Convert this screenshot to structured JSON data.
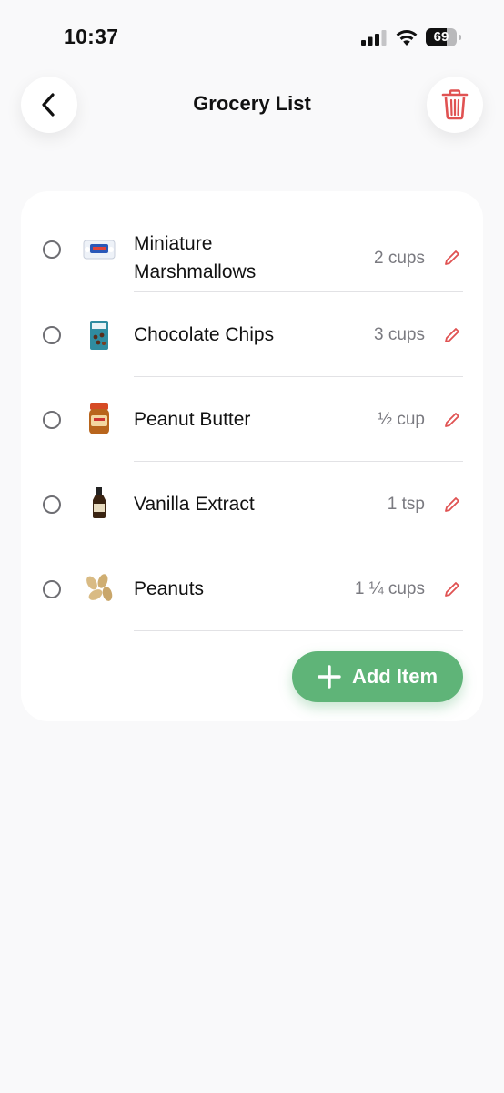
{
  "status": {
    "time": "10:37",
    "battery": "69",
    "battery_level": 0.69
  },
  "header": {
    "title": "Grocery List",
    "back_icon": "chevron-left-icon",
    "delete_icon": "trash-icon"
  },
  "items": [
    {
      "name": "Miniature Marshmallows",
      "quantity": "2 cups",
      "icon": "marshmallow-bag-icon"
    },
    {
      "name": "Chocolate Chips",
      "quantity": "3 cups",
      "icon": "chocolate-chips-bag-icon"
    },
    {
      "name": "Peanut Butter",
      "quantity": "½ cup",
      "icon": "peanut-butter-jar-icon"
    },
    {
      "name": "Vanilla Extract",
      "quantity": "1 tsp",
      "icon": "vanilla-bottle-icon"
    },
    {
      "name": "Peanuts",
      "quantity": "1 ¼ cups",
      "icon": "peanuts-icon"
    }
  ],
  "actions": {
    "add_label": "Add Item"
  },
  "colors": {
    "accent_green": "#5fb478",
    "danger_red": "#e05252",
    "background": "#f9f9fa"
  }
}
